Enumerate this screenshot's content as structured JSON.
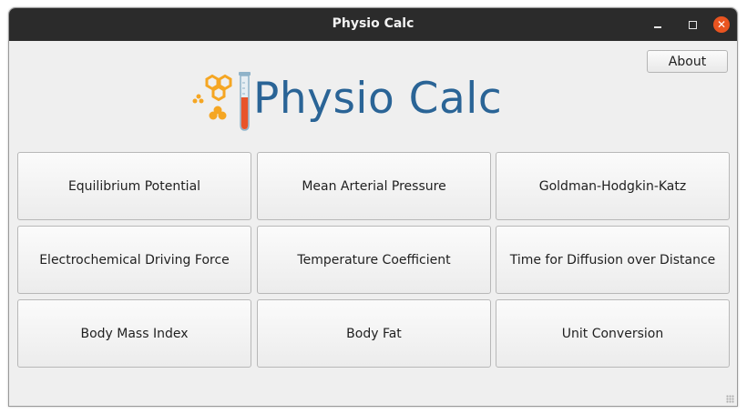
{
  "window": {
    "title": "Physio Calc",
    "controls": {
      "minimize_icon": "minimize-icon",
      "maximize_icon": "maximize-icon",
      "close_icon": "close-icon"
    }
  },
  "header": {
    "logo_text": "Physio Calc",
    "logo_icon": "flask-honeycomb-logo",
    "about_label": "About"
  },
  "colors": {
    "titlebar": "#2b2b2b",
    "close_button": "#e95420",
    "logo_text": "#2a6496",
    "logo_accent": "#f5a623",
    "tube_liquid": "#e8542a",
    "window_bg": "#efefef"
  },
  "calculators": [
    {
      "label": "Equilibrium Potential"
    },
    {
      "label": "Mean Arterial Pressure"
    },
    {
      "label": "Goldman-Hodgkin-Katz"
    },
    {
      "label": "Electrochemical Driving Force"
    },
    {
      "label": "Temperature Coefficient"
    },
    {
      "label": "Time for Diffusion over Distance"
    },
    {
      "label": "Body Mass Index"
    },
    {
      "label": "Body Fat"
    },
    {
      "label": "Unit Conversion"
    }
  ]
}
